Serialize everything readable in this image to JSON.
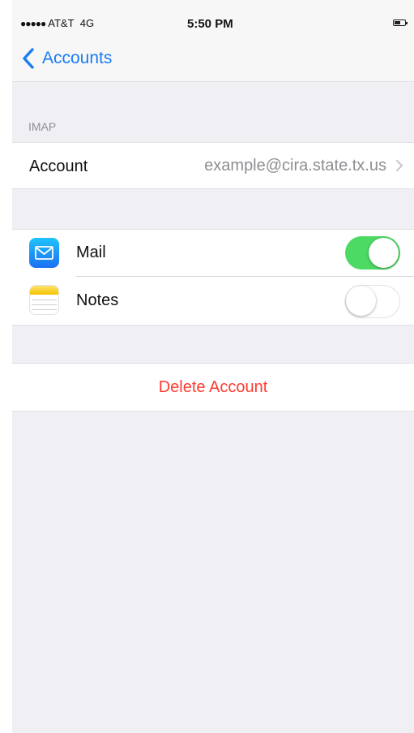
{
  "status_bar": {
    "signal_dots": "●●●●●",
    "carrier": "AT&T",
    "network": "4G",
    "time": "5:50 PM",
    "battery_icon": "battery-icon"
  },
  "nav": {
    "back_label": "Accounts",
    "back_icon": "chevron-left-icon"
  },
  "sections": {
    "imap_header": "IMAP"
  },
  "account": {
    "label": "Account",
    "value": "example@cira.state.tx.us",
    "chevron_icon": "chevron-right-icon"
  },
  "toggles": [
    {
      "label": "Mail",
      "icon": "mail-app-icon",
      "on": true
    },
    {
      "label": "Notes",
      "icon": "notes-app-icon",
      "on": false
    }
  ],
  "delete": {
    "label": "Delete Account"
  },
  "colors": {
    "accent": "#1a7cf5",
    "toggle_on": "#4cd964",
    "destructive": "#ff3b30",
    "background": "#efeff4",
    "secondary_text": "#8e8e93"
  }
}
